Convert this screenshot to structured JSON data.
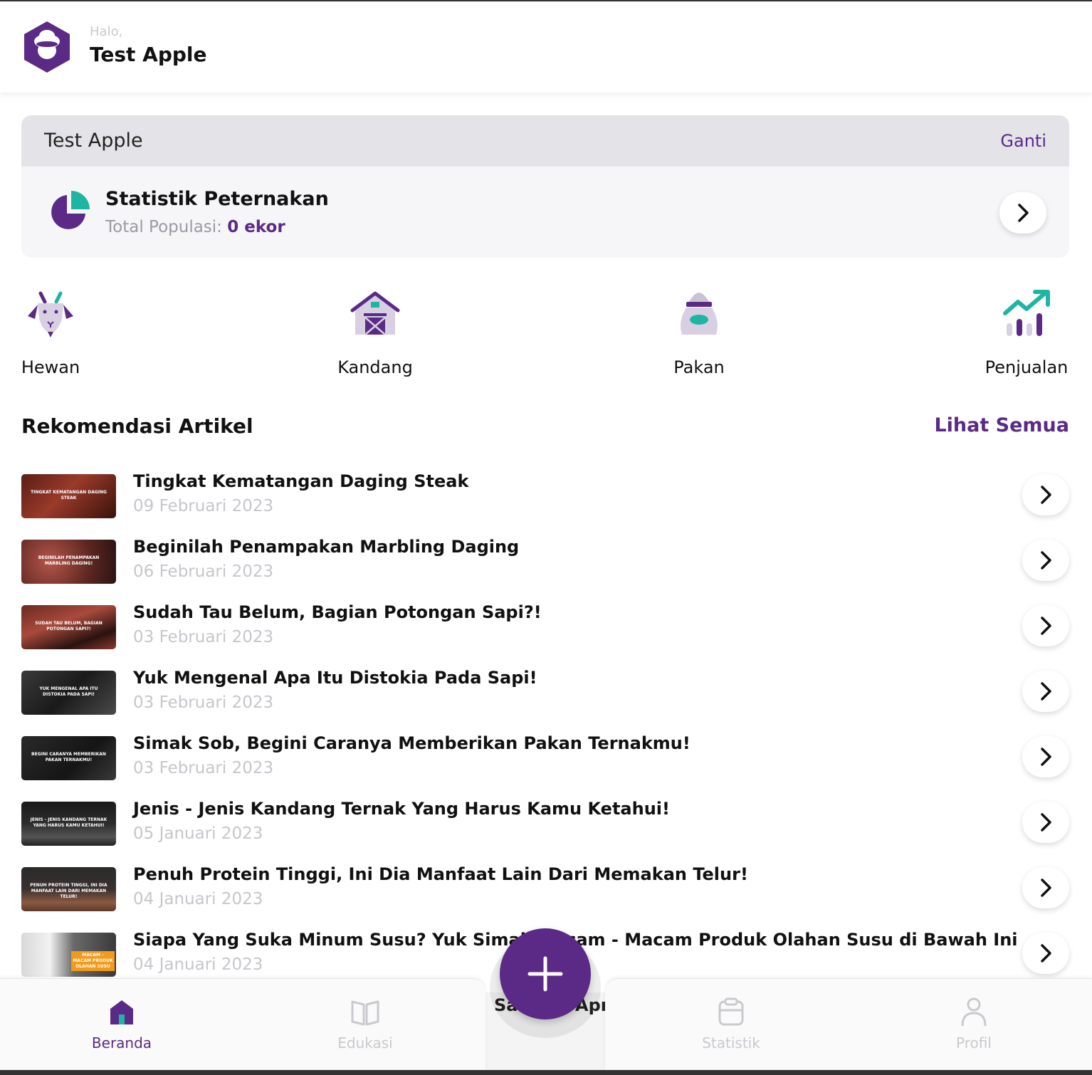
{
  "header": {
    "greeting": "Halo,",
    "user_name": "Test Apple"
  },
  "farm": {
    "name": "Test Apple",
    "change_label": "Ganti",
    "stats_title": "Statistik Peternakan",
    "population_label": "Total Populasi:",
    "population_value": "0 ekor"
  },
  "menu": [
    {
      "label": "Hewan",
      "icon": "goat-icon"
    },
    {
      "label": "Kandang",
      "icon": "barn-icon"
    },
    {
      "label": "Pakan",
      "icon": "feed-sack-icon"
    },
    {
      "label": "Penjualan",
      "icon": "sales-chart-icon"
    }
  ],
  "articles_section": {
    "title": "Rekomendasi Artikel",
    "see_all": "Lihat Semua"
  },
  "articles": [
    {
      "title": "Tingkat Kematangan Daging Steak",
      "date": "09 Februari 2023",
      "thumb_caption": "TINGKAT KEMATANGAN DAGING STEAK"
    },
    {
      "title": "Beginilah Penampakan Marbling Daging",
      "date": "06 Februari 2023",
      "thumb_caption": "BEGINILAH PENAMPAKAN MARBLING DAGING!"
    },
    {
      "title": "Sudah Tau Belum, Bagian Potongan Sapi?!",
      "date": "03 Februari 2023",
      "thumb_caption": "SUDAH TAU BELUM, BAGIAN POTONGAN SAPI?!"
    },
    {
      "title": "Yuk Mengenal Apa Itu Distokia Pada Sapi!",
      "date": "03 Februari 2023",
      "thumb_caption": "YUK MENGENAL APA ITU DISTOKIA PADA SAPI!"
    },
    {
      "title": "Simak Sob, Begini Caranya Memberikan Pakan Ternakmu!",
      "date": "03 Februari 2023",
      "thumb_caption": "BEGINI CARANYA MEMBERIKAN PAKAN TERNAKMU!"
    },
    {
      "title": "Jenis - Jenis Kandang Ternak Yang Harus Kamu Ketahui!",
      "date": "05 Januari 2023",
      "thumb_caption": "JENIS - JENIS KANDANG TERNAK YANG HARUS KAMU KETAHUI!"
    },
    {
      "title": "Penuh Protein Tinggi, Ini Dia Manfaat Lain Dari Memakan Telur!",
      "date": "04 Januari 2023",
      "thumb_caption": "PENUH PROTEIN TINGGI, INI DIA MANFAAT LAIN DARI MEMAKAN TELUR!"
    },
    {
      "title": "Siapa Yang Suka Minum Susu? Yuk Simak Macam - Macam Produk Olahan Susu di Bawah Ini",
      "date": "04 Januari 2023",
      "thumb_caption": "MACAM - MACAM PRODUK OLAHAN SUSU"
    }
  ],
  "bottom_nav": {
    "items": [
      {
        "label": "Beranda",
        "icon": "home-icon",
        "active": true
      },
      {
        "label": "Edukasi",
        "icon": "book-icon",
        "active": false
      },
      {
        "label": "Statistik",
        "icon": "clipboard-icon",
        "active": false
      },
      {
        "label": "Profil",
        "icon": "user-icon",
        "active": false
      }
    ],
    "middle_text_left": "Sa",
    "middle_text_right": "Apr"
  },
  "colors": {
    "primary": "#5b2a86",
    "accent": "#1fb5a3",
    "muted": "#c9c9cf"
  }
}
